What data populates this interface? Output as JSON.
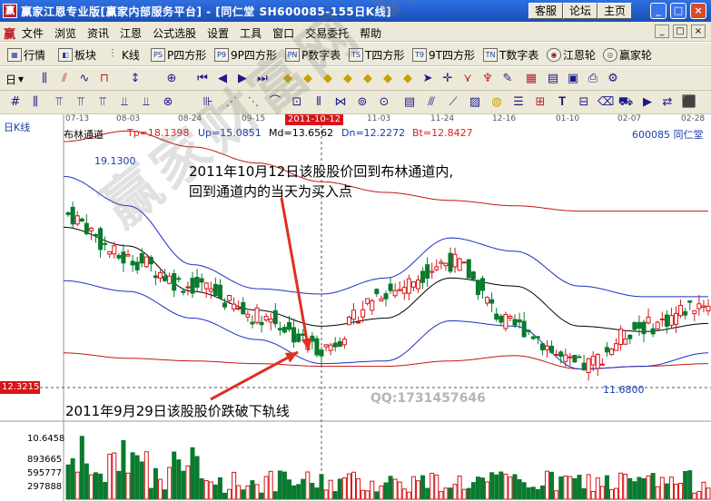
{
  "window": {
    "icon": "赢",
    "title": "赢家江恩专业版[赢家内部服务平台] - [同仁堂   SH600085-155日K线]",
    "buttons": [
      "客服",
      "论坛",
      "主页"
    ],
    "controls": [
      "_",
      "□",
      "×"
    ]
  },
  "menu": {
    "logo": "赢",
    "items": [
      "文件",
      "浏览",
      "资讯",
      "江恩",
      "公式选股",
      "设置",
      "工具",
      "窗口",
      "交易委托",
      "帮助"
    ],
    "mdi": [
      "_",
      "□",
      "×"
    ]
  },
  "toolbar1": [
    {
      "icon": "quote-grid-icon",
      "label": "行情"
    },
    {
      "icon": "sector-icon",
      "label": "板块"
    },
    {
      "icon": "kline-icon",
      "label": "K线"
    },
    {
      "icon": "p-square-icon",
      "tag": "PS",
      "label": "P四方形"
    },
    {
      "icon": "p9-square-icon",
      "tag": "P9",
      "label": "9P四方形"
    },
    {
      "icon": "pn-icon",
      "tag": "PN",
      "label": "P数字表"
    },
    {
      "icon": "t-square-icon",
      "tag": "TS",
      "label": "T四方形"
    },
    {
      "icon": "t9-square-icon",
      "tag": "T9",
      "label": "9T四方形"
    },
    {
      "icon": "tn-icon",
      "tag": "TN",
      "label": "T数字表"
    },
    {
      "icon": "gann-wheel-icon",
      "label": "江恩轮"
    },
    {
      "icon": "winner-wheel-icon",
      "label": "赢家轮"
    }
  ],
  "toolbar2": {
    "period": "日",
    "dropdown": "▾"
  },
  "chart": {
    "period_label": "日K线",
    "indicator_name": "布林通道",
    "tp": "Tp=18.1398",
    "up": "Up=15.0851",
    "md": "Md=13.6562",
    "dn": "Dn=12.2272",
    "bt": "Bt=12.8427",
    "stock": "600085  同仁堂",
    "dates": [
      "07-13",
      "08-03",
      "08-24",
      "09-15",
      "11-03",
      "11-24",
      "12-16",
      "01-10",
      "02-07",
      "02-28"
    ],
    "cursor_date": "2011-10-12",
    "cursor_price": "12.3215",
    "high_label": "19.1300",
    "low_label": "11.6800",
    "annotation_top_1": "2011年10月12日该股股价回到布林通道内,",
    "annotation_top_2": "回到通道内的当天为买入点",
    "annotation_bottom": "2011年9月29日该股股价跌破下轨线",
    "watermark": "赢家财富网 www.yingjia360.com",
    "qq": "QQ:1731457646",
    "volume_labels": [
      "10.6458",
      "893665",
      "595777",
      "297888"
    ],
    "colors": {
      "upper_band": "#c01818",
      "lower_band": "#1a2fc8",
      "mid": "#000000",
      "up_candle": "#d8141a",
      "down_candle": "#0a7a2e",
      "annotation_arrow": "#e03020"
    }
  },
  "chart_data": {
    "type": "line",
    "title": "布林通道",
    "x": [
      "07-13",
      "08-03",
      "08-24",
      "09-15",
      "10-12",
      "11-03",
      "11-24",
      "12-16",
      "01-10",
      "02-07",
      "02-28"
    ],
    "series": [
      {
        "name": "Up",
        "values": [
          19.2,
          18.1,
          15.9,
          15.0,
          14.8,
          15.4,
          16.9,
          16.4,
          15.1,
          14.7,
          14.7
        ]
      },
      {
        "name": "Md",
        "values": [
          17.3,
          16.6,
          14.9,
          14.2,
          13.6,
          13.9,
          15.4,
          15.1,
          13.6,
          13.4,
          13.7
        ]
      },
      {
        "name": "Dn",
        "values": [
          15.3,
          14.9,
          13.9,
          13.1,
          12.2,
          12.3,
          13.8,
          13.6,
          12.0,
          12.1,
          12.6
        ]
      },
      {
        "name": "Tp",
        "values": [
          20.5,
          20.9,
          20.3,
          19.7,
          19.0,
          18.6,
          18.3,
          18.1,
          17.9,
          17.9,
          17.9
        ]
      },
      {
        "name": "Bt",
        "values": [
          12.6,
          12.4,
          12.3,
          12.2,
          12.1,
          12.1,
          12.3,
          12.5,
          12.0,
          12.1,
          12.2
        ]
      },
      {
        "name": "Close",
        "values": [
          17.8,
          16.1,
          15.1,
          14.0,
          12.8,
          14.9,
          16.0,
          13.6,
          12.1,
          13.6,
          14.5
        ]
      }
    ],
    "ylim": [
      11.0,
      20.5
    ]
  }
}
